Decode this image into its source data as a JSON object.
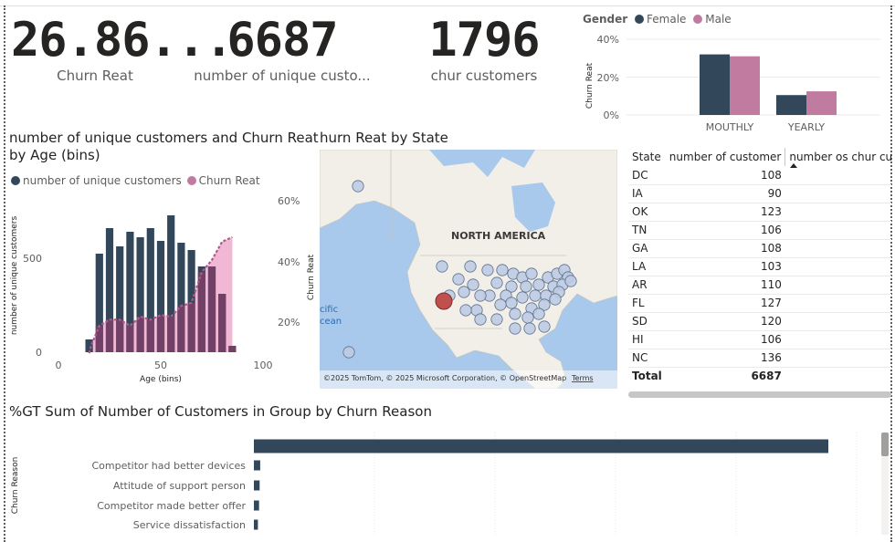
{
  "kpis": [
    {
      "value": "26.86...",
      "label": "Churn Reat"
    },
    {
      "value": "6687",
      "label": "number of unique custo..."
    },
    {
      "value": "1796",
      "label": "chur customers"
    }
  ],
  "colors": {
    "dark": "#33475b",
    "pink": "#c27ba0",
    "pink_area": "#f1b8d5",
    "map_water": "#a8c8ec",
    "map_land": "#f2efe9",
    "bubble": "#bccbe3"
  },
  "gender_chart": {
    "legend_title": "Gender",
    "y_axis_title": "Churn Reat",
    "y_ticks": [
      "40%",
      "20%",
      "0%"
    ]
  },
  "age_chart": {
    "title_line1": "number of unique customers and Churn Reat",
    "title_line2": "by Age (bins)",
    "legend": [
      "number of unique customers",
      "Churn Reat"
    ],
    "y_left_title": "number of unique customers",
    "y_left_ticks": [
      "500",
      "0"
    ],
    "y_right_ticks": [
      "60%",
      "40%",
      "20%"
    ],
    "x_ticks": [
      "0",
      "50",
      "100"
    ],
    "x_title": "Age (bins)"
  },
  "map": {
    "title": "hurn Reat by State",
    "continent_label": "NORTH AMERICA",
    "ocean_label_1": "cific",
    "ocean_label_2": "cean",
    "y_title": "Churn Reat",
    "attribution": "©2025 TomTom, © 2025 Microsoft Corporation, © OpenStreetMap",
    "terms": "Terms"
  },
  "state_table": {
    "headers": [
      "State",
      "number of customer",
      "number os chur cus"
    ],
    "rows": [
      {
        "state": "DC",
        "customers": "108"
      },
      {
        "state": "IA",
        "customers": "90"
      },
      {
        "state": "OK",
        "customers": "123"
      },
      {
        "state": "TN",
        "customers": "106"
      },
      {
        "state": "GA",
        "customers": "108"
      },
      {
        "state": "LA",
        "customers": "103"
      },
      {
        "state": "AR",
        "customers": "110"
      },
      {
        "state": "FL",
        "customers": "127"
      },
      {
        "state": "SD",
        "customers": "120"
      },
      {
        "state": "HI",
        "customers": "106"
      },
      {
        "state": "NC",
        "customers": "136"
      }
    ],
    "total_label": "Total",
    "total_value": "6687"
  },
  "reason_chart": {
    "title": "%GT Sum of Number of Customers in Group by Churn Reason",
    "y_title": "Churn Reason"
  },
  "chart_data": [
    {
      "type": "bar",
      "categories": [
        "MOUTHLY",
        "YEARLY"
      ],
      "series": [
        {
          "name": "Female",
          "values": [
            32,
            10.5
          ]
        },
        {
          "name": "Male",
          "values": [
            31,
            12.5
          ]
        }
      ],
      "ylabel": "Churn Reat",
      "ylim": [
        0,
        45
      ],
      "legend": "top"
    },
    {
      "type": "bar",
      "title": "number of unique customers and Churn Reat by Age (bins)",
      "xlabel": "Age (bins)",
      "ylabel": "number of unique customers",
      "xlim": [
        0,
        100
      ],
      "ylim": [
        0,
        750
      ],
      "x": [
        15,
        20,
        25,
        30,
        35,
        40,
        45,
        50,
        55,
        60,
        65,
        70,
        75,
        80,
        85
      ],
      "series": [
        {
          "name": "number of unique customers",
          "values": [
            70,
            540,
            680,
            580,
            660,
            630,
            680,
            610,
            750,
            600,
            560,
            470,
            470,
            320,
            35
          ]
        },
        {
          "name": "Churn Reat",
          "axis": "right",
          "ylim": [
            6,
            64
          ],
          "x": [
            15,
            16,
            20,
            25,
            30,
            35,
            40,
            45,
            50,
            55,
            60,
            65,
            70,
            75,
            80,
            85
          ],
          "values": [
            9.5,
            12,
            18.5,
            20.5,
            20.5,
            18.5,
            21.5,
            20.5,
            22,
            21.5,
            25,
            26,
            36,
            40,
            46,
            47.5
          ]
        }
      ],
      "legend": "top-left"
    },
    {
      "type": "bar",
      "title": "%GT Sum of Number of Customers in Group by Churn Reason",
      "ylabel": "Churn Reason",
      "categories": [
        "",
        "Competitor had better devices",
        "Attitude of support person",
        "Competitor made better offer",
        "Service dissatisfaction"
      ],
      "values": [
        100,
        1.1,
        1.0,
        0.9,
        0.7
      ],
      "orientation": "horizontal"
    }
  ]
}
